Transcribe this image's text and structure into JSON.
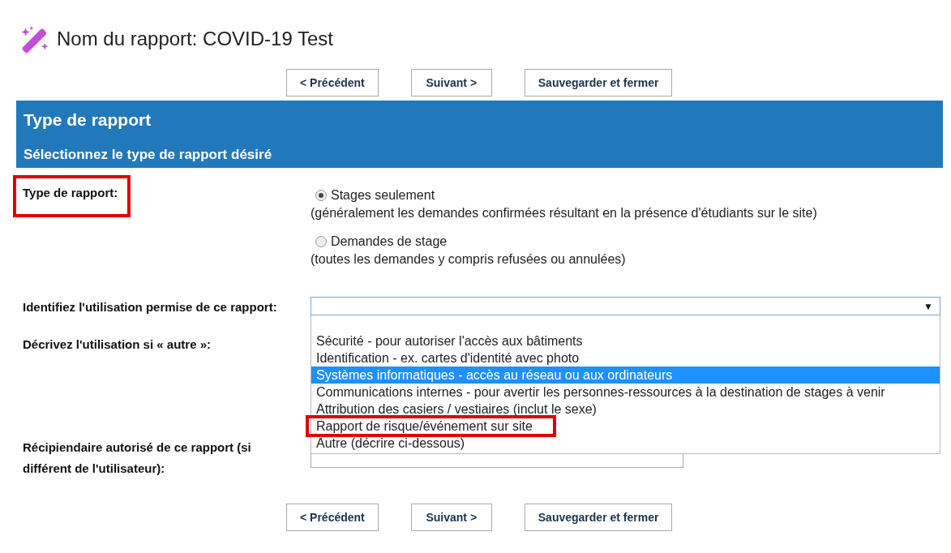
{
  "title": "Nom du rapport: COVID-19 Test",
  "nav_top": [
    "< Précédent",
    "Suivant >",
    "Sauvegarder et fermer"
  ],
  "section": {
    "title": "Type de rapport",
    "subtitle": "Sélectionnez le type de rapport désiré"
  },
  "report_type": {
    "label": "Type de rapport:",
    "highlighted": true,
    "options": [
      {
        "label": "Stages seulement",
        "hint": "(généralement les demandes confirmées résultant en la présence d'étudiants sur le site)",
        "selected": true
      },
      {
        "label": "Demandes de stage",
        "hint": "(toutes les demandes y compris refusées ou annulées)",
        "selected": false
      }
    ]
  },
  "usage": {
    "label": "Identifiez l'utilisation permise de ce rapport:",
    "arrow": "▼",
    "expanded": true,
    "options": [
      {
        "label": "Sécurité - pour autoriser l'accès aux bâtiments",
        "selected": false,
        "highlighted": false
      },
      {
        "label": "Identification - ex. cartes d'identité avec photo",
        "selected": false,
        "highlighted": false
      },
      {
        "label": "Systèmes informatiques - accès au réseau ou aux ordinateurs",
        "selected": true,
        "highlighted": false
      },
      {
        "label": "Communications internes - pour avertir les personnes-ressources à la destination de stages à venir",
        "selected": false,
        "highlighted": false
      },
      {
        "label": "Attribution des casiers / vestiaires (inclut le sexe)",
        "selected": false,
        "highlighted": false
      },
      {
        "label": "Rapport de risque/événement sur site",
        "selected": false,
        "highlighted": true
      },
      {
        "label": "Autre (décrire ci-dessous)",
        "selected": false,
        "highlighted": false
      }
    ]
  },
  "describe": {
    "label": "Décrivez l'utilisation si « autre »:"
  },
  "recipient": {
    "label": "Récipiendaire autorisé de ce rapport (si différent de l'utilisateur):"
  },
  "nav_bottom": [
    "< Précédent",
    "Suivant >",
    "Sauvegarder et fermer"
  ]
}
